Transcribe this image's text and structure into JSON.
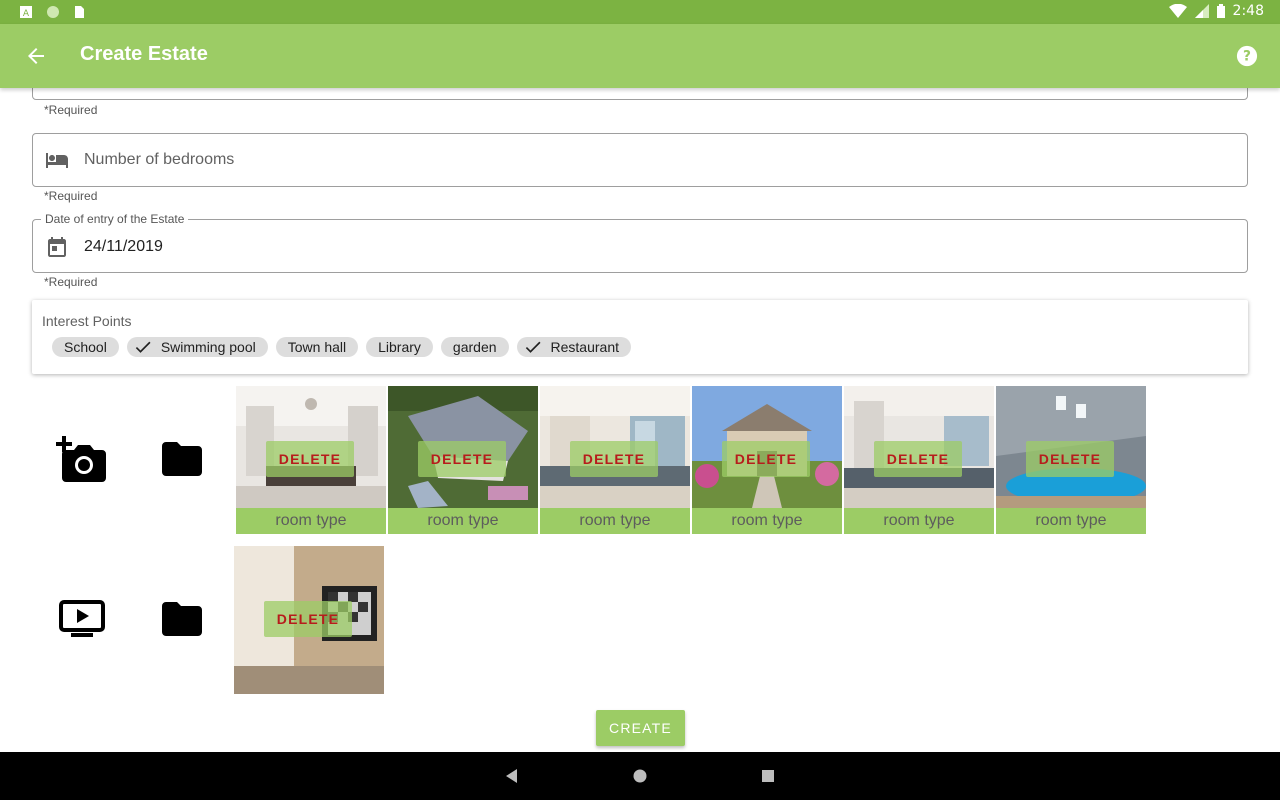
{
  "status_bar": {
    "time": "2:48"
  },
  "app_bar": {
    "title": "Create Estate"
  },
  "form": {
    "top_field_helper": "*Required",
    "bedrooms": {
      "placeholder": "Number of bedrooms",
      "helper": "*Required"
    },
    "entry_date": {
      "label": "Date of entry of the Estate",
      "value": "24/11/2019",
      "helper": "*Required"
    }
  },
  "interest_points": {
    "title": "Interest Points",
    "chips": [
      {
        "label": "School",
        "checked": false
      },
      {
        "label": "Swimming pool",
        "checked": true
      },
      {
        "label": "Town hall",
        "checked": false
      },
      {
        "label": "Library",
        "checked": false
      },
      {
        "label": "garden",
        "checked": false
      },
      {
        "label": "Restaurant",
        "checked": true
      }
    ]
  },
  "photos": {
    "delete_label": "DELETE",
    "room_type_label": "room type",
    "items": [
      {
        "scene": "kitchen"
      },
      {
        "scene": "aerial-house"
      },
      {
        "scene": "kitchen-window"
      },
      {
        "scene": "house-front"
      },
      {
        "scene": "kitchen"
      },
      {
        "scene": "indoor-pool"
      }
    ]
  },
  "videos": {
    "delete_label": "DELETE",
    "items": [
      {
        "scene": "living-room-tv"
      }
    ]
  },
  "create_button": {
    "label": "CREATE"
  },
  "colors": {
    "status_bar": "#7cb342",
    "app_bar": "#9ccc65",
    "delete_text": "#b71c1c",
    "chip_bg": "#dddddd"
  }
}
